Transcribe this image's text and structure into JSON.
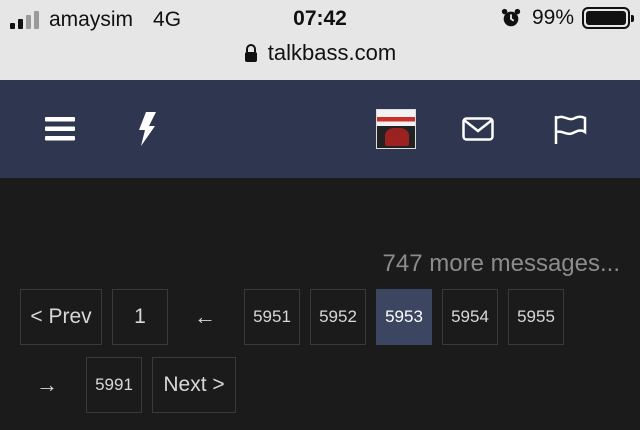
{
  "status_bar": {
    "carrier": "amaysim",
    "network": "4G",
    "time": "07:42",
    "battery_percent": "99%",
    "battery_level": 0.99
  },
  "url_bar": {
    "domain": "talkbass.com"
  },
  "header": {
    "icons": [
      "menu-icon",
      "bolt-icon",
      "avatar",
      "mail-icon",
      "flag-icon"
    ],
    "background": "#2f3650"
  },
  "pagination": {
    "more_messages": "747 more messages...",
    "prev_label": "< Prev",
    "next_label": "Next >",
    "first_page": "1",
    "jump_back_arrow": "←",
    "pages": [
      "5951",
      "5952",
      "5953",
      "5954",
      "5955"
    ],
    "current_page": "5953",
    "jump_forward_arrow": "→",
    "last_page": "5991",
    "active_color": "#3c4660"
  }
}
